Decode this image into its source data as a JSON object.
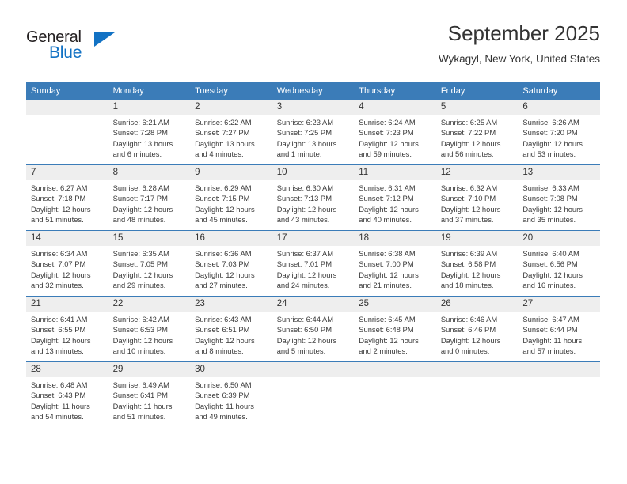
{
  "brand": {
    "name_primary": "General",
    "name_secondary": "Blue",
    "primary_color": "#231f20",
    "secondary_color": "#1272c4",
    "triangle_icon": "triangle-icon"
  },
  "header": {
    "title": "September 2025",
    "subtitle": "Wykagyl, New York, United States"
  },
  "theme": {
    "header_bg": "#3b7cb8",
    "daynum_bg": "#eeeeee",
    "row_border": "#3b7cb8",
    "text": "#333333"
  },
  "calendar": {
    "weekday_headers": [
      "Sunday",
      "Monday",
      "Tuesday",
      "Wednesday",
      "Thursday",
      "Friday",
      "Saturday"
    ],
    "weeks": [
      [
        {
          "day": "",
          "empty": true
        },
        {
          "day": "1",
          "sunrise": "Sunrise: 6:21 AM",
          "sunset": "Sunset: 7:28 PM",
          "daylight": "Daylight: 13 hours and 6 minutes."
        },
        {
          "day": "2",
          "sunrise": "Sunrise: 6:22 AM",
          "sunset": "Sunset: 7:27 PM",
          "daylight": "Daylight: 13 hours and 4 minutes."
        },
        {
          "day": "3",
          "sunrise": "Sunrise: 6:23 AM",
          "sunset": "Sunset: 7:25 PM",
          "daylight": "Daylight: 13 hours and 1 minute."
        },
        {
          "day": "4",
          "sunrise": "Sunrise: 6:24 AM",
          "sunset": "Sunset: 7:23 PM",
          "daylight": "Daylight: 12 hours and 59 minutes."
        },
        {
          "day": "5",
          "sunrise": "Sunrise: 6:25 AM",
          "sunset": "Sunset: 7:22 PM",
          "daylight": "Daylight: 12 hours and 56 minutes."
        },
        {
          "day": "6",
          "sunrise": "Sunrise: 6:26 AM",
          "sunset": "Sunset: 7:20 PM",
          "daylight": "Daylight: 12 hours and 53 minutes."
        }
      ],
      [
        {
          "day": "7",
          "sunrise": "Sunrise: 6:27 AM",
          "sunset": "Sunset: 7:18 PM",
          "daylight": "Daylight: 12 hours and 51 minutes."
        },
        {
          "day": "8",
          "sunrise": "Sunrise: 6:28 AM",
          "sunset": "Sunset: 7:17 PM",
          "daylight": "Daylight: 12 hours and 48 minutes."
        },
        {
          "day": "9",
          "sunrise": "Sunrise: 6:29 AM",
          "sunset": "Sunset: 7:15 PM",
          "daylight": "Daylight: 12 hours and 45 minutes."
        },
        {
          "day": "10",
          "sunrise": "Sunrise: 6:30 AM",
          "sunset": "Sunset: 7:13 PM",
          "daylight": "Daylight: 12 hours and 43 minutes."
        },
        {
          "day": "11",
          "sunrise": "Sunrise: 6:31 AM",
          "sunset": "Sunset: 7:12 PM",
          "daylight": "Daylight: 12 hours and 40 minutes."
        },
        {
          "day": "12",
          "sunrise": "Sunrise: 6:32 AM",
          "sunset": "Sunset: 7:10 PM",
          "daylight": "Daylight: 12 hours and 37 minutes."
        },
        {
          "day": "13",
          "sunrise": "Sunrise: 6:33 AM",
          "sunset": "Sunset: 7:08 PM",
          "daylight": "Daylight: 12 hours and 35 minutes."
        }
      ],
      [
        {
          "day": "14",
          "sunrise": "Sunrise: 6:34 AM",
          "sunset": "Sunset: 7:07 PM",
          "daylight": "Daylight: 12 hours and 32 minutes."
        },
        {
          "day": "15",
          "sunrise": "Sunrise: 6:35 AM",
          "sunset": "Sunset: 7:05 PM",
          "daylight": "Daylight: 12 hours and 29 minutes."
        },
        {
          "day": "16",
          "sunrise": "Sunrise: 6:36 AM",
          "sunset": "Sunset: 7:03 PM",
          "daylight": "Daylight: 12 hours and 27 minutes."
        },
        {
          "day": "17",
          "sunrise": "Sunrise: 6:37 AM",
          "sunset": "Sunset: 7:01 PM",
          "daylight": "Daylight: 12 hours and 24 minutes."
        },
        {
          "day": "18",
          "sunrise": "Sunrise: 6:38 AM",
          "sunset": "Sunset: 7:00 PM",
          "daylight": "Daylight: 12 hours and 21 minutes."
        },
        {
          "day": "19",
          "sunrise": "Sunrise: 6:39 AM",
          "sunset": "Sunset: 6:58 PM",
          "daylight": "Daylight: 12 hours and 18 minutes."
        },
        {
          "day": "20",
          "sunrise": "Sunrise: 6:40 AM",
          "sunset": "Sunset: 6:56 PM",
          "daylight": "Daylight: 12 hours and 16 minutes."
        }
      ],
      [
        {
          "day": "21",
          "sunrise": "Sunrise: 6:41 AM",
          "sunset": "Sunset: 6:55 PM",
          "daylight": "Daylight: 12 hours and 13 minutes."
        },
        {
          "day": "22",
          "sunrise": "Sunrise: 6:42 AM",
          "sunset": "Sunset: 6:53 PM",
          "daylight": "Daylight: 12 hours and 10 minutes."
        },
        {
          "day": "23",
          "sunrise": "Sunrise: 6:43 AM",
          "sunset": "Sunset: 6:51 PM",
          "daylight": "Daylight: 12 hours and 8 minutes."
        },
        {
          "day": "24",
          "sunrise": "Sunrise: 6:44 AM",
          "sunset": "Sunset: 6:50 PM",
          "daylight": "Daylight: 12 hours and 5 minutes."
        },
        {
          "day": "25",
          "sunrise": "Sunrise: 6:45 AM",
          "sunset": "Sunset: 6:48 PM",
          "daylight": "Daylight: 12 hours and 2 minutes."
        },
        {
          "day": "26",
          "sunrise": "Sunrise: 6:46 AM",
          "sunset": "Sunset: 6:46 PM",
          "daylight": "Daylight: 12 hours and 0 minutes."
        },
        {
          "day": "27",
          "sunrise": "Sunrise: 6:47 AM",
          "sunset": "Sunset: 6:44 PM",
          "daylight": "Daylight: 11 hours and 57 minutes."
        }
      ],
      [
        {
          "day": "28",
          "sunrise": "Sunrise: 6:48 AM",
          "sunset": "Sunset: 6:43 PM",
          "daylight": "Daylight: 11 hours and 54 minutes."
        },
        {
          "day": "29",
          "sunrise": "Sunrise: 6:49 AM",
          "sunset": "Sunset: 6:41 PM",
          "daylight": "Daylight: 11 hours and 51 minutes."
        },
        {
          "day": "30",
          "sunrise": "Sunrise: 6:50 AM",
          "sunset": "Sunset: 6:39 PM",
          "daylight": "Daylight: 11 hours and 49 minutes."
        },
        {
          "day": "",
          "empty": true
        },
        {
          "day": "",
          "empty": true
        },
        {
          "day": "",
          "empty": true
        },
        {
          "day": "",
          "empty": true
        }
      ]
    ]
  }
}
